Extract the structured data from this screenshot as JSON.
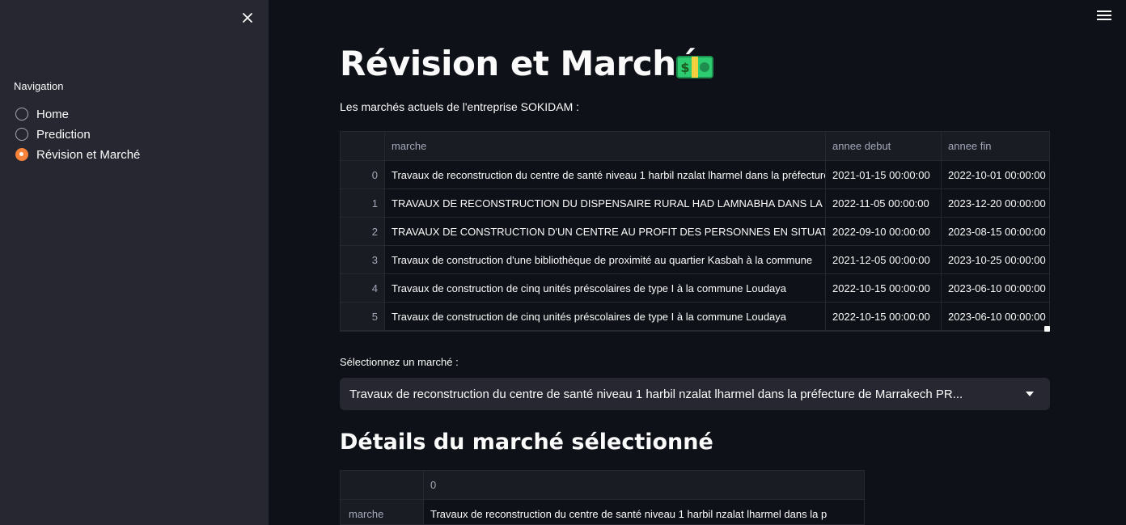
{
  "sidebar": {
    "nav_title": "Navigation",
    "items": [
      {
        "label": "Home",
        "selected": false
      },
      {
        "label": "Prediction",
        "selected": false
      },
      {
        "label": "Révision et Marché",
        "selected": true
      }
    ]
  },
  "page": {
    "title": "Révision et Marché",
    "title_icon": "money-icon",
    "subtitle": "Les marchés actuels de l'entreprise SOKIDAM :"
  },
  "table": {
    "columns": [
      "",
      "marche",
      "annee debut",
      "annee fin"
    ],
    "rows": [
      {
        "idx": "0",
        "marche": "Travaux de reconstruction du centre de santé niveau 1 harbil nzalat lharmel dans la préfecture de Marrakech PR…",
        "debut": "2021-01-15 00:00:00",
        "fin": "2022-10-01 00:00:00"
      },
      {
        "idx": "1",
        "marche": "TRAVAUX DE RECONSTRUCTION DU DISPENSAIRE RURAL HAD LAMNABHA DANS LA PROVINCE",
        "debut": "2022-11-05 00:00:00",
        "fin": "2023-12-20 00:00:00"
      },
      {
        "idx": "2",
        "marche": "TRAVAUX DE CONSTRUCTION D'UN CENTRE AU PROFIT DES PERSONNES EN SITUATION",
        "debut": "2022-09-10 00:00:00",
        "fin": "2023-08-15 00:00:00"
      },
      {
        "idx": "3",
        "marche": "Travaux de construction d'une bibliothèque de proximité au quartier Kasbah à la commune",
        "debut": "2021-12-05 00:00:00",
        "fin": "2023-10-25 00:00:00"
      },
      {
        "idx": "4",
        "marche": "Travaux de construction de cinq unités préscolaires de type I à la commune Loudaya",
        "debut": "2022-10-15 00:00:00",
        "fin": "2023-06-10 00:00:00"
      },
      {
        "idx": "5",
        "marche": "Travaux de construction de cinq unités préscolaires de type I à la commune Loudaya",
        "debut": "2022-10-15 00:00:00",
        "fin": "2023-06-10 00:00:00"
      }
    ]
  },
  "select": {
    "label": "Sélectionnez un marché :",
    "value": "Travaux de reconstruction du centre de santé niveau 1 harbil nzalat lharmel dans la préfecture de Marrakech PR..."
  },
  "details": {
    "title": "Détails du marché sélectionné",
    "header_col": "0",
    "rows": [
      {
        "key": "marche",
        "value": "Travaux de reconstruction du centre de santé niveau 1 harbil nzalat lharmel dans la p"
      }
    ]
  }
}
